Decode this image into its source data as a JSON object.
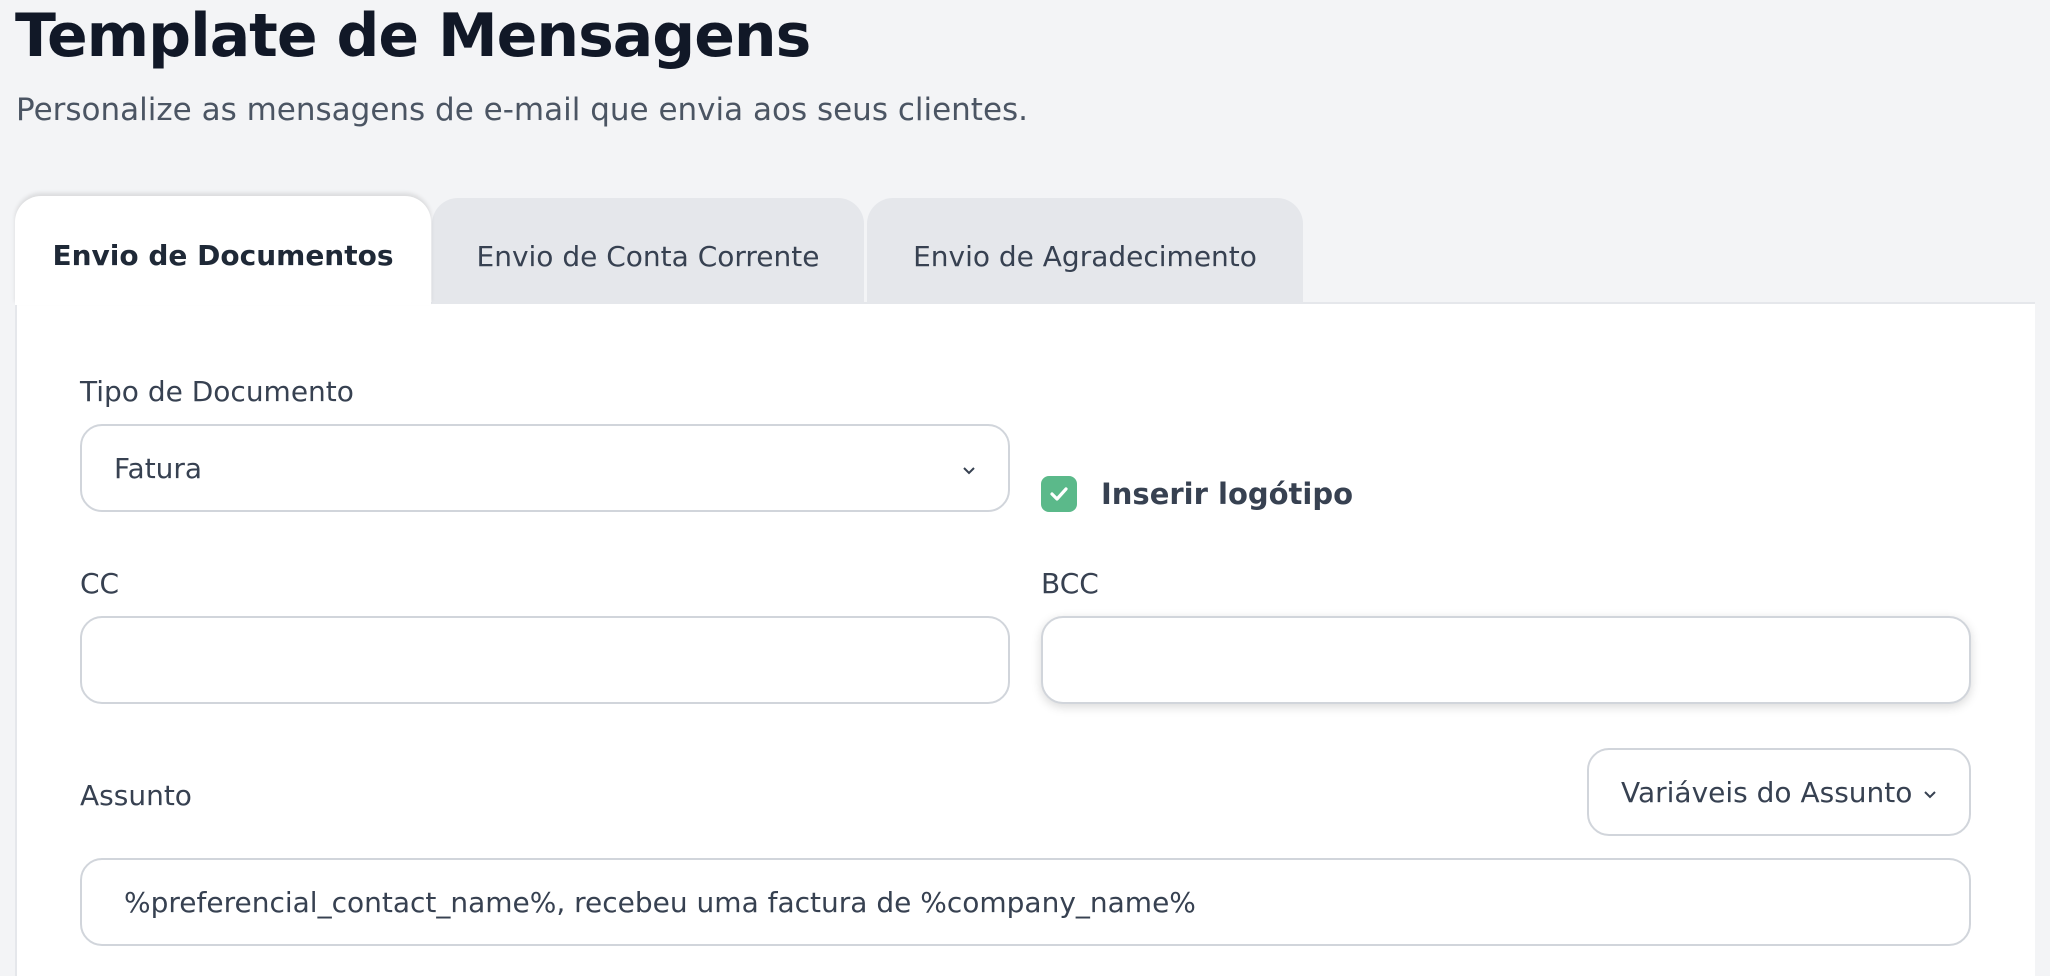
{
  "header": {
    "title": "Template de Mensagens",
    "subtitle": "Personalize as mensagens de e-mail que envia aos seus clientes."
  },
  "tabs": [
    {
      "label": "Envio de Documentos",
      "active": true
    },
    {
      "label": "Envio de Conta Corrente",
      "active": false
    },
    {
      "label": "Envio de Agradecimento",
      "active": false
    }
  ],
  "form": {
    "document_type": {
      "label": "Tipo de Documento",
      "value": "Fatura"
    },
    "insert_logo": {
      "label": "Inserir logótipo",
      "checked": true
    },
    "cc": {
      "label": "CC",
      "value": ""
    },
    "bcc": {
      "label": "BCC",
      "value": ""
    },
    "subject": {
      "label": "Assunto",
      "variables_label": "Variáveis do Assunto",
      "value": "%preferencial_contact_name%, recebeu uma factura de %company_name%"
    }
  },
  "colors": {
    "accent_green": "#5bb98a",
    "background": "#f3f4f6"
  }
}
